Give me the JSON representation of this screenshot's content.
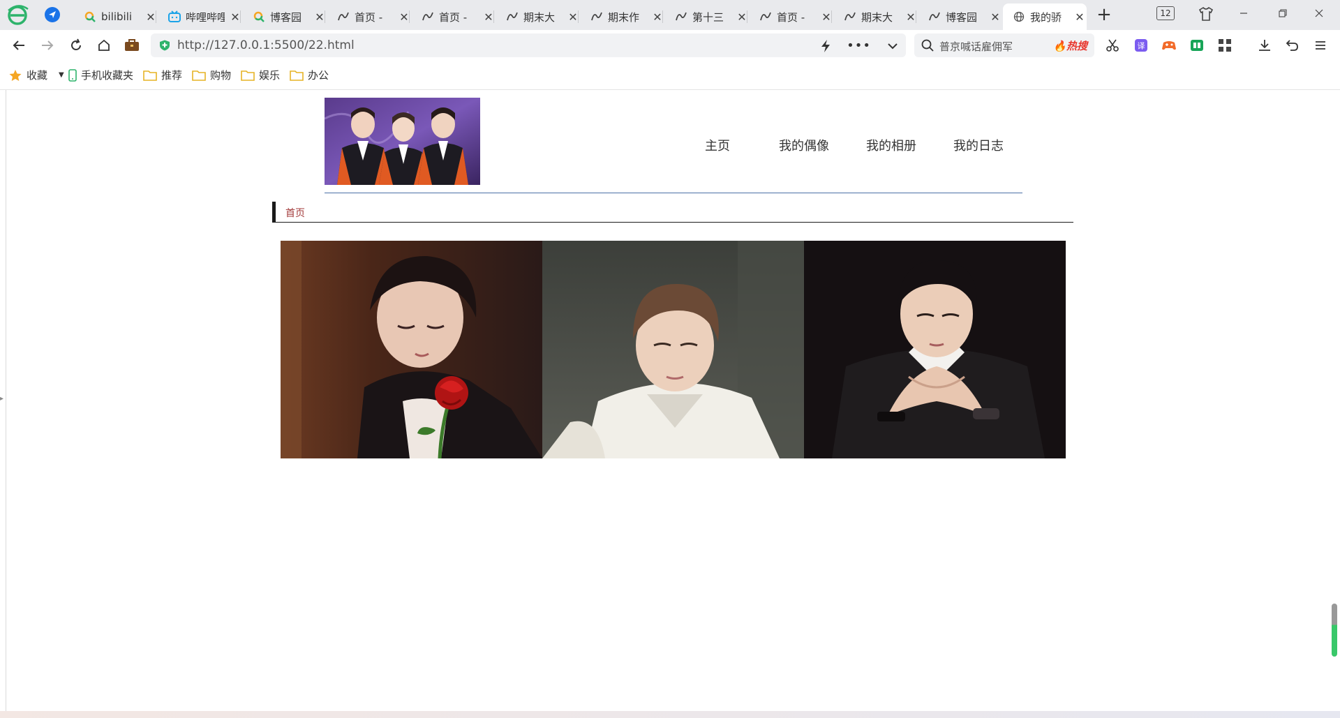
{
  "browser": {
    "tabs": [
      {
        "title": "bilibili",
        "icon": "bilibili-search-icon"
      },
      {
        "title": "哔哩哔哩",
        "icon": "bilibili-tv-icon"
      },
      {
        "title": "博客园",
        "icon": "search-logo-icon"
      },
      {
        "title": "首页 -",
        "icon": "vscode-icon"
      },
      {
        "title": "首页 -",
        "icon": "vscode-icon"
      },
      {
        "title": "期末大",
        "icon": "vscode-icon"
      },
      {
        "title": "期末作",
        "icon": "vscode-icon"
      },
      {
        "title": "第十三",
        "icon": "vscode-icon"
      },
      {
        "title": "首页 -",
        "icon": "vscode-icon"
      },
      {
        "title": "期末大",
        "icon": "vscode-icon"
      },
      {
        "title": "博客园",
        "icon": "vscode-icon"
      },
      {
        "title": "我的骄",
        "icon": "globe-icon",
        "active": true
      }
    ],
    "tab_count": "12",
    "url": "http://127.0.0.1:5500/22.html",
    "search_text": "普京喊话雇佣军",
    "hot_label": "热搜",
    "accent_color": "#39c86a"
  },
  "bookmarks": [
    {
      "label": "收藏",
      "icon": "star-icon"
    },
    {
      "label": "手机收藏夹",
      "icon": "phone-icon"
    },
    {
      "label": "推荐",
      "icon": "folder-icon"
    },
    {
      "label": "购物",
      "icon": "folder-icon"
    },
    {
      "label": "娱乐",
      "icon": "folder-icon"
    },
    {
      "label": "办公",
      "icon": "folder-icon"
    }
  ],
  "site": {
    "nav": [
      {
        "label": "主页"
      },
      {
        "label": "我的偶像"
      },
      {
        "label": "我的相册"
      },
      {
        "label": "我的日志"
      }
    ],
    "breadcrumb": "首页",
    "photos": [
      {
        "name": "photo-rose"
      },
      {
        "name": "photo-white-shirt"
      },
      {
        "name": "photo-black-sweater"
      }
    ]
  }
}
